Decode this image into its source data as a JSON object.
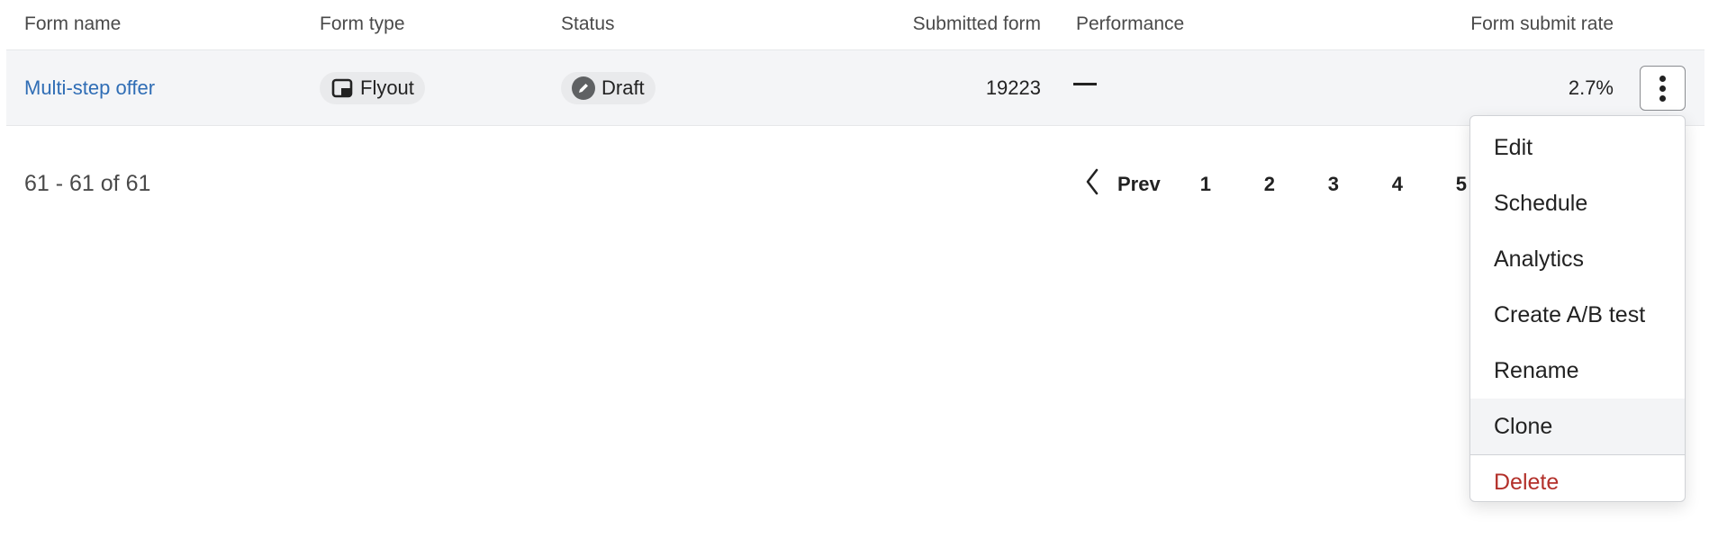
{
  "table": {
    "columns": [
      "Form name",
      "Form type",
      "Status",
      "Submitted form",
      "Performance",
      "Form submit rate"
    ],
    "rows": [
      {
        "form_name": "Multi-step offer",
        "form_type": "Flyout",
        "form_type_icon": "flyout-icon",
        "status": "Draft",
        "status_icon": "pencil-icon",
        "submitted_form": "19223",
        "performance": "—",
        "form_submit_rate": "2.7%"
      }
    ]
  },
  "pagination": {
    "range_text": "61 - 61 of 61",
    "prev_label": "Prev",
    "pages": [
      "1",
      "2",
      "3",
      "4",
      "5"
    ]
  },
  "row_menu": {
    "items": [
      {
        "label": "Edit"
      },
      {
        "label": "Schedule"
      },
      {
        "label": "Analytics"
      },
      {
        "label": "Create A/B test"
      },
      {
        "label": "Rename"
      },
      {
        "label": "Clone",
        "hovered": true
      },
      {
        "label": "Delete",
        "danger": true
      }
    ]
  },
  "colors": {
    "link": "#2f6db5",
    "row_bg": "#f4f5f7",
    "danger": "#b3302a"
  }
}
